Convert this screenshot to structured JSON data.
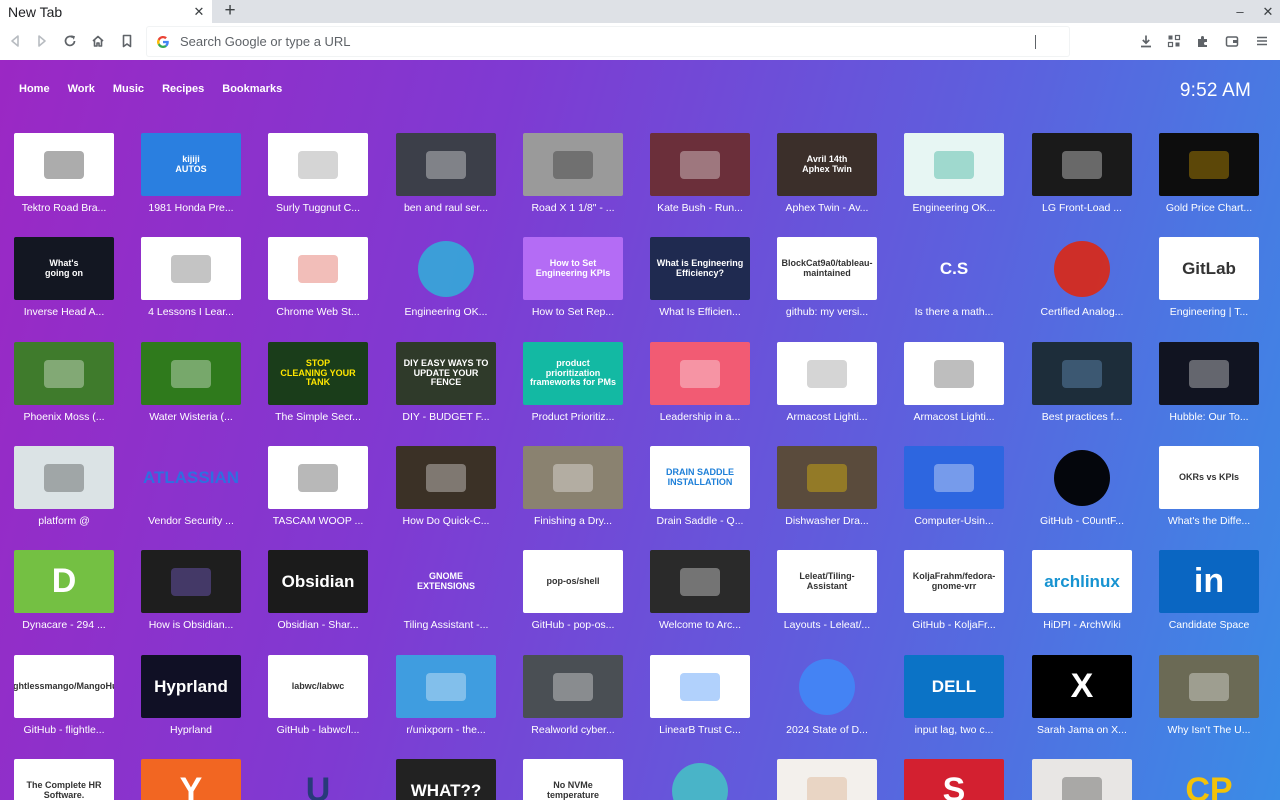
{
  "tab": {
    "title": "New Tab",
    "close": "✕",
    "new_tab": "+"
  },
  "window": {
    "minimize": "–",
    "close": "✕"
  },
  "omnibox": {
    "placeholder": "Search Google or type a URL"
  },
  "nav": [
    "Home",
    "Work",
    "Music",
    "Recipes",
    "Bookmarks"
  ],
  "clock": "9:52 AM",
  "colors": {
    "page_gradient_start": "#9b28c4",
    "page_gradient_end": "#3a8ce6"
  },
  "tiles": [
    {
      "label": "Tektro Road Bra...",
      "bg": "#ffffff",
      "fg": "#111111",
      "icon": "bike-brake-image"
    },
    {
      "label": "1981 Honda Pre...",
      "bg": "#2a7fe0",
      "fg": "#ffffff",
      "text": "kijiji\nAUTOS"
    },
    {
      "label": "Surly Tuggnut C...",
      "bg": "#ffffff",
      "fg": "#888888",
      "icon": "bike-part-image"
    },
    {
      "label": "ben and raul ser...",
      "bg": "#3c3f49",
      "fg": "#ffffff",
      "icon": "photo"
    },
    {
      "label": "Road X 1 1/8\" - ...",
      "bg": "#9a9a9a",
      "fg": "#222222",
      "icon": "photo"
    },
    {
      "label": "Kate Bush - Run...",
      "bg": "#6b2f3a",
      "fg": "#ffffff",
      "icon": "video-thumbnail"
    },
    {
      "label": "Aphex Twin - Av...",
      "bg": "#3b2f2a",
      "fg": "#ffffff",
      "text": "Avril 14th\nAphex Twin"
    },
    {
      "label": "Engineering OK...",
      "bg": "#e7f6f3",
      "fg": "#1aa38a",
      "icon": "terminal-icon"
    },
    {
      "label": "LG Front-Load ...",
      "bg": "#1a1a1a",
      "fg": "#ffffff",
      "icon": "washer-image"
    },
    {
      "label": "Gold Price Chart...",
      "bg": "#0d0d0d",
      "fg": "#f0b400",
      "icon": "chart-image"
    },
    {
      "label": "Inverse Head A...",
      "bg": "#131722",
      "fg": "#ffffff",
      "text": "What's\ngoing on"
    },
    {
      "label": "4 Lessons I Lear...",
      "bg": "#ffffff",
      "fg": "#555555",
      "icon": "document-image"
    },
    {
      "label": "Chrome Web St...",
      "bg": "#ffffff",
      "fg": "#db4437",
      "icon": "chrome-icon"
    },
    {
      "label": "Engineering OK...",
      "bg": "transparent",
      "fg": "#38a3d8",
      "icon": "circle-logo"
    },
    {
      "label": "How to Set Rep...",
      "bg": "#b46cf5",
      "fg": "#ffffff",
      "text": "How to Set Engineering KPIs"
    },
    {
      "label": "What Is Efficien...",
      "bg": "#1f2a50",
      "fg": "#ffffff",
      "text": "What is Engineering Efficiency?"
    },
    {
      "label": "github: my versi...",
      "bg": "#ffffff",
      "fg": "#333333",
      "text": "BlockCat9a0/tableau-maintained"
    },
    {
      "label": "Is there a math...",
      "bg": "transparent",
      "fg": "#ffffff",
      "text": "C.S"
    },
    {
      "label": "Certified Analog...",
      "bg": "transparent",
      "fg": "#d52b1e",
      "icon": "maple-leaf-icon"
    },
    {
      "label": "Engineering | T...",
      "bg": "#ffffff",
      "fg": "#333333",
      "text": "GitLab"
    },
    {
      "label": "Phoenix Moss (...",
      "bg": "#3f7b2c",
      "fg": "#ffffff",
      "icon": "photo"
    },
    {
      "label": "Water Wisteria (...",
      "bg": "#2f7a1c",
      "fg": "#ffffff",
      "icon": "photo"
    },
    {
      "label": "The Simple Secr...",
      "bg": "#1a3d1a",
      "fg": "#ffe600",
      "text": "STOP\nCLEANING YOUR\nTANK"
    },
    {
      "label": "DIY - BUDGET F...",
      "bg": "#2f3a2a",
      "fg": "#ffffff",
      "text": "DIY EASY WAYS TO\nUPDATE YOUR FENCE"
    },
    {
      "label": "Product Prioritiz...",
      "bg": "#13b9a3",
      "fg": "#ffffff",
      "text": "product prioritization frameworks for PMs"
    },
    {
      "label": "Leadership in a...",
      "bg": "#f25b73",
      "fg": "#ffffff",
      "icon": "illustration"
    },
    {
      "label": "Armacost Lighti...",
      "bg": "#ffffff",
      "fg": "#888888",
      "icon": "product-image"
    },
    {
      "label": "Armacost Lighti...",
      "bg": "#ffffff",
      "fg": "#444444",
      "icon": "product-image"
    },
    {
      "label": "Best practices f...",
      "bg": "#1d2d3a",
      "fg": "#7ad",
      "icon": "diagram-image"
    },
    {
      "label": "Hubble: Our To...",
      "bg": "#111421",
      "fg": "#ffffff",
      "icon": "space-image"
    },
    {
      "label": "platform @",
      "bg": "#dbe3e5",
      "fg": "#333333",
      "icon": "office-photo"
    },
    {
      "label": "Vendor Security ...",
      "bg": "transparent",
      "fg": "#2f6fe0",
      "text": "ATLASSIAN"
    },
    {
      "label": "TASCAM WOOP ...",
      "bg": "#ffffff",
      "fg": "#333333",
      "icon": "audio-device-image"
    },
    {
      "label": "How Do Quick-C...",
      "bg": "#3b3126",
      "fg": "#ffffff",
      "icon": "video-thumbnail"
    },
    {
      "label": "Finishing a Dry...",
      "bg": "#8a8270",
      "fg": "#ffffff",
      "icon": "photo"
    },
    {
      "label": "Drain Saddle - Q...",
      "bg": "#ffffff",
      "fg": "#1d7fd8",
      "text": "DRAIN SADDLE\nINSTALLATION"
    },
    {
      "label": "Dishwasher Dra...",
      "bg": "#5a4b3c",
      "fg": "#ffd400",
      "icon": "photo"
    },
    {
      "label": "Computer-Usin...",
      "bg": "#2d66e0",
      "fg": "#ffffff",
      "icon": "ui-image"
    },
    {
      "label": "GitHub - C0untF...",
      "bg": "transparent",
      "fg": "#000000",
      "icon": "github-icon"
    },
    {
      "label": "What's the Diffe...",
      "bg": "#ffffff",
      "fg": "#333333",
      "text": "OKRs vs KPIs"
    },
    {
      "label": "Dynacare - 294 ...",
      "bg": "#74c043",
      "fg": "#ffffff",
      "text": "D"
    },
    {
      "label": "How is Obsidian...",
      "bg": "#1e1e1e",
      "fg": "#8b6cf0",
      "icon": "obsidian-icon"
    },
    {
      "label": "Obsidian - Shar...",
      "bg": "#1b1b1b",
      "fg": "#ffffff",
      "text": "Obsidian"
    },
    {
      "label": "Tiling Assistant -...",
      "bg": "transparent",
      "fg": "#ffffff",
      "text": "GNOME\nEXTENSIONS"
    },
    {
      "label": "GitHub - pop-os...",
      "bg": "#ffffff",
      "fg": "#333333",
      "text": "pop-os/shell"
    },
    {
      "label": "Welcome to Arc...",
      "bg": "#2a2a2a",
      "fg": "#ffffff",
      "icon": "grid-image"
    },
    {
      "label": "Layouts - Leleat/...",
      "bg": "#ffffff",
      "fg": "#333333",
      "text": "Leleat/Tiling-Assistant"
    },
    {
      "label": "GitHub - KoljaFr...",
      "bg": "#ffffff",
      "fg": "#333333",
      "text": "KoljaFrahm/fedora-gnome-vrr"
    },
    {
      "label": "HiDPI - ArchWiki",
      "bg": "#ffffff",
      "fg": "#1793d1",
      "text": "archlinux"
    },
    {
      "label": "Candidate Space",
      "bg": "#0a66c2",
      "fg": "#ffffff",
      "text": "in"
    },
    {
      "label": "GitHub - flightle...",
      "bg": "#ffffff",
      "fg": "#333333",
      "text": "flightlessmango/MangoHud"
    },
    {
      "label": "Hyprland",
      "bg": "#101025",
      "fg": "#ffffff",
      "text": "Hyprland"
    },
    {
      "label": "GitHub - labwc/l...",
      "bg": "#ffffff",
      "fg": "#333333",
      "text": "labwc/labwc"
    },
    {
      "label": "r/unixporn - the...",
      "bg": "#3f9de0",
      "fg": "#ffffff",
      "icon": "terminal-icon"
    },
    {
      "label": "Realworld cyber...",
      "bg": "#4a4f54",
      "fg": "#ffffff",
      "icon": "photo"
    },
    {
      "label": "LinearB Trust C...",
      "bg": "#ffffff",
      "fg": "#1f7bf5",
      "icon": "linearb-icon"
    },
    {
      "label": "2024 State of D...",
      "bg": "transparent",
      "fg": "#4285f4",
      "icon": "gcloud-icon"
    },
    {
      "label": "input lag, two c...",
      "bg": "#0b73c6",
      "fg": "#ffffff",
      "text": "DELL"
    },
    {
      "label": "Sarah Jama on X...",
      "bg": "#000000",
      "fg": "#ffffff",
      "text": "X"
    },
    {
      "label": "Why Isn't The U...",
      "bg": "#6b6a55",
      "fg": "#ffffff",
      "icon": "video-thumbnail"
    },
    {
      "label": "",
      "bg": "#ffffff",
      "fg": "#333333",
      "text": "The Complete HR Software."
    },
    {
      "label": "",
      "bg": "#f26622",
      "fg": "#ffffff",
      "text": "Y"
    },
    {
      "label": "",
      "bg": "transparent",
      "fg": "#283a7a",
      "text": "U"
    },
    {
      "label": "",
      "bg": "#222222",
      "fg": "#ffffff",
      "text": "WHAT??"
    },
    {
      "label": "",
      "bg": "#ffffff",
      "fg": "#333333",
      "text": "No NVMe temperature"
    },
    {
      "label": "",
      "bg": "transparent",
      "fg": "#48b9c7",
      "icon": "pop-os-icon"
    },
    {
      "label": "",
      "bg": "#f3f0ec",
      "fg": "#d6a27a",
      "icon": "avatar"
    },
    {
      "label": "",
      "bg": "#d32030",
      "fg": "#ffffff",
      "text": "S"
    },
    {
      "label": "",
      "bg": "#e8e6e4",
      "fg": "#333333",
      "icon": "photo"
    },
    {
      "label": "",
      "bg": "transparent",
      "fg": "#f2c20a",
      "text": "CP"
    }
  ]
}
